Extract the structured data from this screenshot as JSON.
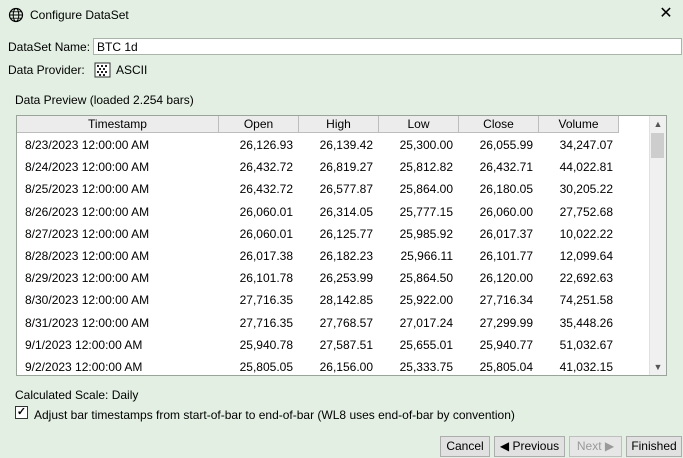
{
  "window": {
    "title": "Configure DataSet",
    "close_glyph": "✕"
  },
  "dataset_name": {
    "label": "DataSet Name:",
    "value": "BTC 1d"
  },
  "data_provider": {
    "label": "Data Provider:",
    "value": "ASCII"
  },
  "preview": {
    "title": "Data Preview (loaded 2.254 bars)",
    "columns": [
      "Timestamp",
      "Open",
      "High",
      "Low",
      "Close",
      "Volume"
    ],
    "rows": [
      [
        "8/23/2023 12:00:00 AM",
        "26,126.93",
        "26,139.42",
        "25,300.00",
        "26,055.99",
        "34,247.07"
      ],
      [
        "8/24/2023 12:00:00 AM",
        "26,432.72",
        "26,819.27",
        "25,812.82",
        "26,432.71",
        "44,022.81"
      ],
      [
        "8/25/2023 12:00:00 AM",
        "26,432.72",
        "26,577.87",
        "25,864.00",
        "26,180.05",
        "30,205.22"
      ],
      [
        "8/26/2023 12:00:00 AM",
        "26,060.01",
        "26,314.05",
        "25,777.15",
        "26,060.00",
        "27,752.68"
      ],
      [
        "8/27/2023 12:00:00 AM",
        "26,060.01",
        "26,125.77",
        "25,985.92",
        "26,017.37",
        "10,022.22"
      ],
      [
        "8/28/2023 12:00:00 AM",
        "26,017.38",
        "26,182.23",
        "25,966.11",
        "26,101.77",
        "12,099.64"
      ],
      [
        "8/29/2023 12:00:00 AM",
        "26,101.78",
        "26,253.99",
        "25,864.50",
        "26,120.00",
        "22,692.63"
      ],
      [
        "8/30/2023 12:00:00 AM",
        "27,716.35",
        "28,142.85",
        "25,922.00",
        "27,716.34",
        "74,251.58"
      ],
      [
        "8/31/2023 12:00:00 AM",
        "27,716.35",
        "27,768.57",
        "27,017.24",
        "27,299.99",
        "35,448.26"
      ],
      [
        "9/1/2023 12:00:00 AM",
        "25,940.78",
        "27,587.51",
        "25,655.01",
        "25,940.77",
        "51,032.67"
      ],
      [
        "9/2/2023 12:00:00 AM",
        "25,805.05",
        "26,156.00",
        "25,333.75",
        "25,805.04",
        "41,032.15"
      ]
    ]
  },
  "calculated_scale": "Calculated Scale: Daily",
  "adjust_checkbox": {
    "checked": true,
    "label": "Adjust bar timestamps from start-of-bar to end-of-bar (WL8 uses end-of-bar by convention)"
  },
  "buttons": {
    "cancel": "Cancel",
    "previous": "◀ Previous",
    "next": "Next ▶",
    "finished": "Finished"
  },
  "icons": {
    "app": "globe-icon",
    "provider": "ascii-file-icon"
  }
}
